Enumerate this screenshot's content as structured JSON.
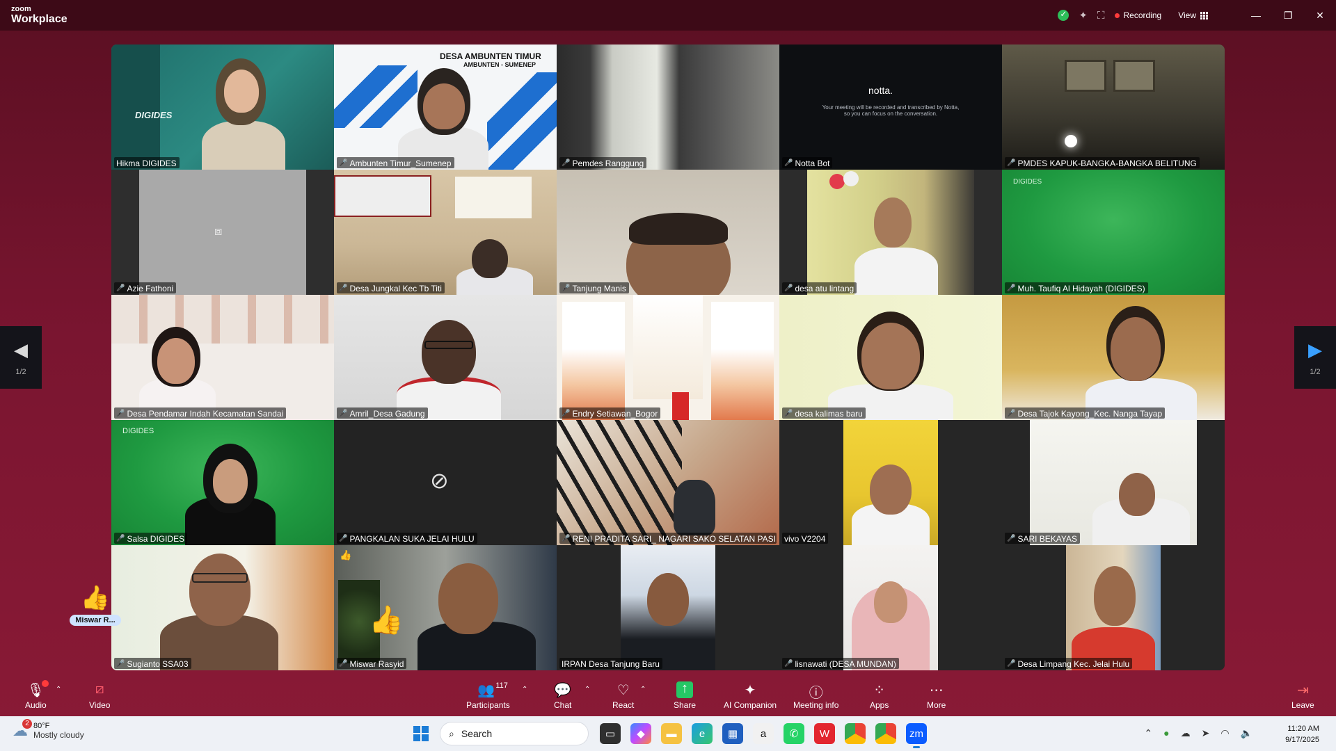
{
  "app": {
    "brand_top": "zoom",
    "brand_bottom": "Workplace"
  },
  "titlebar": {
    "recording_label": "Recording",
    "view_label": "View"
  },
  "participants": [
    {
      "name": "Hikma DIGIDES",
      "muted": false,
      "active": true
    },
    {
      "name": "Ambunten Timur_Sumenep",
      "muted": true
    },
    {
      "name": "Pemdes Ranggung",
      "muted": true
    },
    {
      "name": "Notta Bot",
      "muted": true
    },
    {
      "name": "PMDES KAPUK-BANGKA-BANGKA BELITUNG",
      "muted": true
    },
    {
      "name": "Azie Fathoni",
      "muted": true
    },
    {
      "name": "Desa Jungkal Kec Tb Titi",
      "muted": true
    },
    {
      "name": "Tanjung Manis",
      "muted": true
    },
    {
      "name": "desa atu lintang",
      "muted": true
    },
    {
      "name": "Muh. Taufiq Al Hidayah (DIGIDES)",
      "muted": true
    },
    {
      "name": "Desa Pendamar Indah Kecamatan Sandai",
      "muted": true
    },
    {
      "name": "Amril_Desa Gadung",
      "muted": true
    },
    {
      "name": "Endry Setiawan_Bogor",
      "muted": true
    },
    {
      "name": "desa kalimas baru",
      "muted": true
    },
    {
      "name": "Desa Tajok Kayong_Kec. Nanga Tayap",
      "muted": true
    },
    {
      "name": "Salsa DIGIDES",
      "muted": true
    },
    {
      "name": "PANGKALAN SUKA JELAI HULU",
      "muted": true
    },
    {
      "name": "RENI PRADITA SARI_ NAGARI SAKO SELATAN PASI...",
      "muted": true
    },
    {
      "name": "vivo V2204",
      "muted": false
    },
    {
      "name": "SARI BEKAYAS",
      "muted": true
    },
    {
      "name": "Sugianto SSA03",
      "muted": true
    },
    {
      "name": "Miswar Rasyid",
      "muted": true
    },
    {
      "name": "IRPAN Desa Tanjung Baru",
      "muted": false
    },
    {
      "name": "lisnawati (DESA MUNDAN)",
      "muted": true
    },
    {
      "name": "Desa Limpang Kec. Jelai Hulu",
      "muted": true
    }
  ],
  "tile_text": {
    "ambunten_banner_1": "DESA AMBUNTEN TIMUR",
    "ambunten_banner_2": "AMBUNTEN - SUMENEP",
    "notta_logo": "notta.",
    "notta_msg": "Your meeting will be recorded and transcribed by Notta, so you can focus on the conversation.",
    "digides_logo": "DIGIDES"
  },
  "pagination": {
    "left": "1/2",
    "right": "1/2"
  },
  "reaction": {
    "who": "Miswar R...",
    "emoji": "👍"
  },
  "toolbar": {
    "audio": "Audio",
    "video": "Video",
    "participants": "Participants",
    "participants_count": "117",
    "chat": "Chat",
    "react": "React",
    "share": "Share",
    "ai": "AI Companion",
    "info": "Meeting info",
    "apps": "Apps",
    "more": "More",
    "leave": "Leave"
  },
  "taskbar": {
    "temp": "80°F",
    "weather": "Mostly cloudy",
    "weather_badge": "2",
    "search_placeholder": "Search",
    "time": "11:20 AM",
    "date": "9/17/2025"
  }
}
